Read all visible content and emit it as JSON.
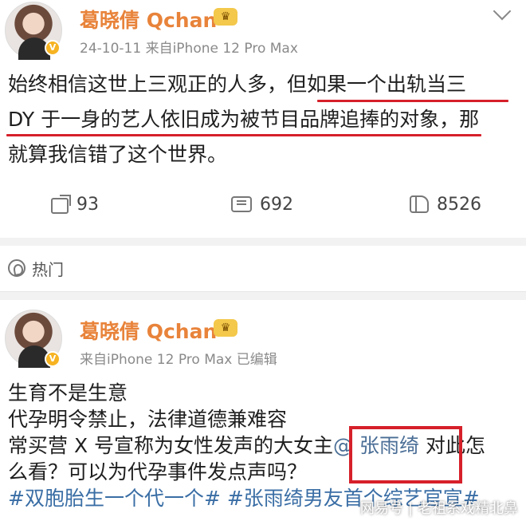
{
  "post1": {
    "username": "葛晓倩 Qchan",
    "crown_icon": "crown-icon",
    "meta": "24-10-11  来自iPhone 12 Pro Max",
    "text_lines": [
      "始终相信这世上三观正的人多，但如果一个出轨当三",
      "DY 于一身的艺人依旧成为被节目品牌追捧的对象，那",
      "就算我信错了这个世界。"
    ],
    "actions": {
      "share_count": "93",
      "comment_count": "692",
      "like_count": "8526"
    },
    "highlight_color": "#d6202a"
  },
  "hot_section": {
    "label": "热门"
  },
  "post2": {
    "username": "葛晓倩 Qchan",
    "meta": "来自iPhone 12 Pro Max  已编辑",
    "line1": "生育不是生意",
    "line2": "代孕明令禁止，法律道德兼难容",
    "line3_prefix": "常买营 X 号宣称为女性发声的大女主",
    "mention": "@ 张雨绮",
    "line3_suffix": " 对此怎",
    "line4": "么看？可以为代孕事件发点声吗？",
    "hashtags": "#双胞胎生一个代一个# #张雨绮男友首个综艺官宣#"
  },
  "watermark": {
    "left": "网易号",
    "right": "老祖系戏精北鼻"
  },
  "colors": {
    "username": "#e8833a",
    "mention": "#4a6e96",
    "box_red": "#d6202a"
  }
}
